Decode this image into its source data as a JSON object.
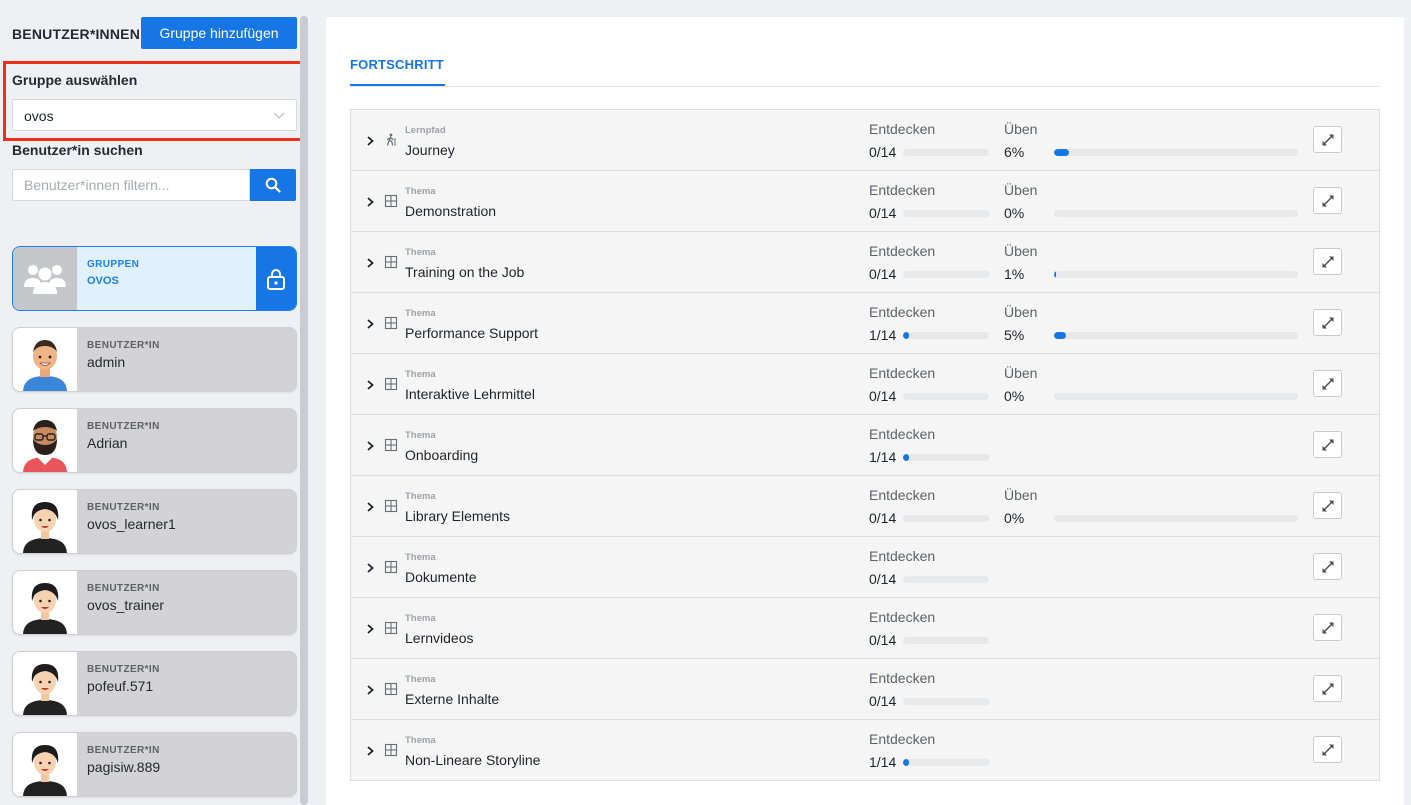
{
  "sidebar": {
    "title": "BENUTZER*INNEN",
    "add_group_label": "Gruppe hinzufügen",
    "group_select_label": "Gruppe auswählen",
    "group_select_value": "ovos",
    "search_label": "Benutzer*in suchen",
    "search_placeholder": "Benutzer*innen filtern...",
    "group_card": {
      "kind": "GRUPPEN",
      "name": "OVOS"
    },
    "users": [
      {
        "kind": "BENUTZER*IN",
        "name": "admin",
        "avatar": "avatar-man-blue-shirt"
      },
      {
        "kind": "BENUTZER*IN",
        "name": "Adrian",
        "avatar": "avatar-man-glasses-beard"
      },
      {
        "kind": "BENUTZER*IN",
        "name": "ovos_learner1",
        "avatar": "avatar-woman-dark-hair"
      },
      {
        "kind": "BENUTZER*IN",
        "name": "ovos_trainer",
        "avatar": "avatar-woman-dark-hair"
      },
      {
        "kind": "BENUTZER*IN",
        "name": "pofeuf.571",
        "avatar": "avatar-woman-dark-hair"
      },
      {
        "kind": "BENUTZER*IN",
        "name": "pagisiw.889",
        "avatar": "avatar-woman-dark-hair"
      }
    ]
  },
  "main": {
    "tab": "FORTSCHRITT",
    "labels": {
      "discover": "Entdecken",
      "practice": "Üben"
    },
    "rows": [
      {
        "type": "Lernpfad",
        "icon": "hiking-person-icon",
        "name": "Journey",
        "discover": "0/14",
        "discover_frac": 0.0,
        "practice": "6%",
        "practice_frac": 0.06
      },
      {
        "type": "Thema",
        "icon": "grid-icon",
        "name": "Demonstration",
        "discover": "0/14",
        "discover_frac": 0.0,
        "practice": "0%",
        "practice_frac": 0.0
      },
      {
        "type": "Thema",
        "icon": "grid-icon",
        "name": "Training on the Job",
        "discover": "0/14",
        "discover_frac": 0.0,
        "practice": "1%",
        "practice_frac": 0.01
      },
      {
        "type": "Thema",
        "icon": "grid-icon",
        "name": "Performance Support",
        "discover": "1/14",
        "discover_frac": 0.0714,
        "practice": "5%",
        "practice_frac": 0.05
      },
      {
        "type": "Thema",
        "icon": "grid-icon",
        "name": "Interaktive Lehrmittel",
        "discover": "0/14",
        "discover_frac": 0.0,
        "practice": "0%",
        "practice_frac": 0.0
      },
      {
        "type": "Thema",
        "icon": "grid-icon",
        "name": "Onboarding",
        "discover": "1/14",
        "discover_frac": 0.0714,
        "practice": null,
        "practice_frac": null
      },
      {
        "type": "Thema",
        "icon": "grid-icon",
        "name": "Library Elements",
        "discover": "0/14",
        "discover_frac": 0.0,
        "practice": "0%",
        "practice_frac": 0.0
      },
      {
        "type": "Thema",
        "icon": "grid-icon",
        "name": "Dokumente",
        "discover": "0/14",
        "discover_frac": 0.0,
        "practice": null,
        "practice_frac": null
      },
      {
        "type": "Thema",
        "icon": "grid-icon",
        "name": "Lernvideos",
        "discover": "0/14",
        "discover_frac": 0.0,
        "practice": null,
        "practice_frac": null
      },
      {
        "type": "Thema",
        "icon": "grid-icon",
        "name": "Externe Inhalte",
        "discover": "0/14",
        "discover_frac": 0.0,
        "practice": null,
        "practice_frac": null
      },
      {
        "type": "Thema",
        "icon": "grid-icon",
        "name": "Non-Lineare Storyline",
        "discover": "1/14",
        "discover_frac": 0.0714,
        "practice": null,
        "practice_frac": null
      }
    ]
  },
  "colors": {
    "accent": "#1676e5",
    "highlight": "#ee2f1a"
  }
}
